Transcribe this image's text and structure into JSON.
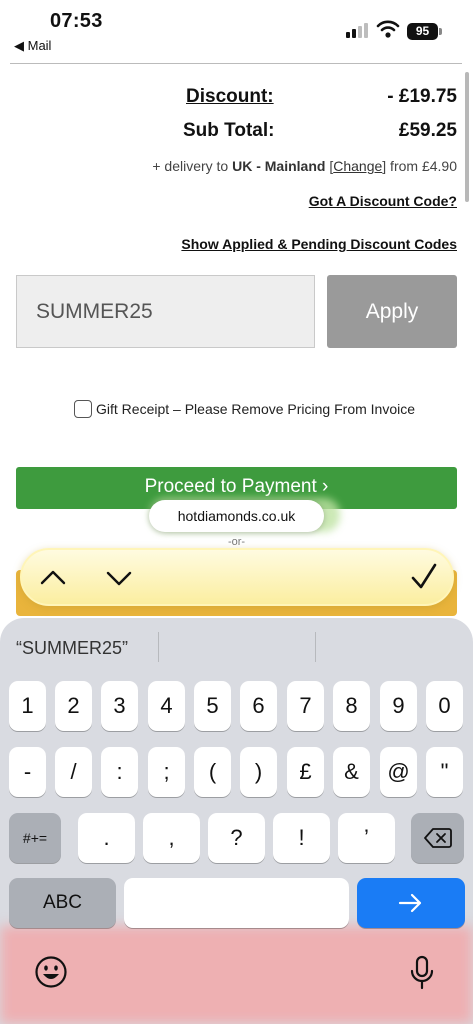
{
  "status": {
    "time": "07:53",
    "back_app": "◀ Mail",
    "battery": "95"
  },
  "cart": {
    "discount_label": "Discount:",
    "discount_value": "- £19.75",
    "subtotal_label": "Sub Total:",
    "subtotal_value": "£59.25",
    "delivery_prefix": "+ delivery to ",
    "delivery_region": "UK - Mainland",
    "delivery_open": " [",
    "delivery_change": "Change",
    "delivery_close": "]",
    "delivery_suffix": " from £4.90",
    "got_code_link": "Got A Discount Code?",
    "show_applied_link": "Show Applied & Pending Discount Codes",
    "code_value": "SUMMER25",
    "apply_label": "Apply",
    "gift_label": "Gift Receipt – Please Remove Pricing From Invoice",
    "proceed_label": "Proceed to Payment ›",
    "or_label": "-or-"
  },
  "browser": {
    "site": "hotdiamonds.co.uk"
  },
  "keyboard": {
    "suggestion": "“SUMMER25”",
    "row1": [
      "1",
      "2",
      "3",
      "4",
      "5",
      "6",
      "7",
      "8",
      "9",
      "0"
    ],
    "row2": [
      "-",
      "/",
      ":",
      ";",
      "(",
      ")",
      "£",
      "&",
      "@",
      "\""
    ],
    "row3": [
      ".",
      ",",
      "?",
      "!",
      "’"
    ],
    "symbols_key": "#+=",
    "abc_key": "ABC"
  },
  "colors": {
    "proceed": "#3e9b3e",
    "apply": "#9a9a9a",
    "return_key": "#1a7cf5",
    "find_bar": "#fbeea0"
  }
}
